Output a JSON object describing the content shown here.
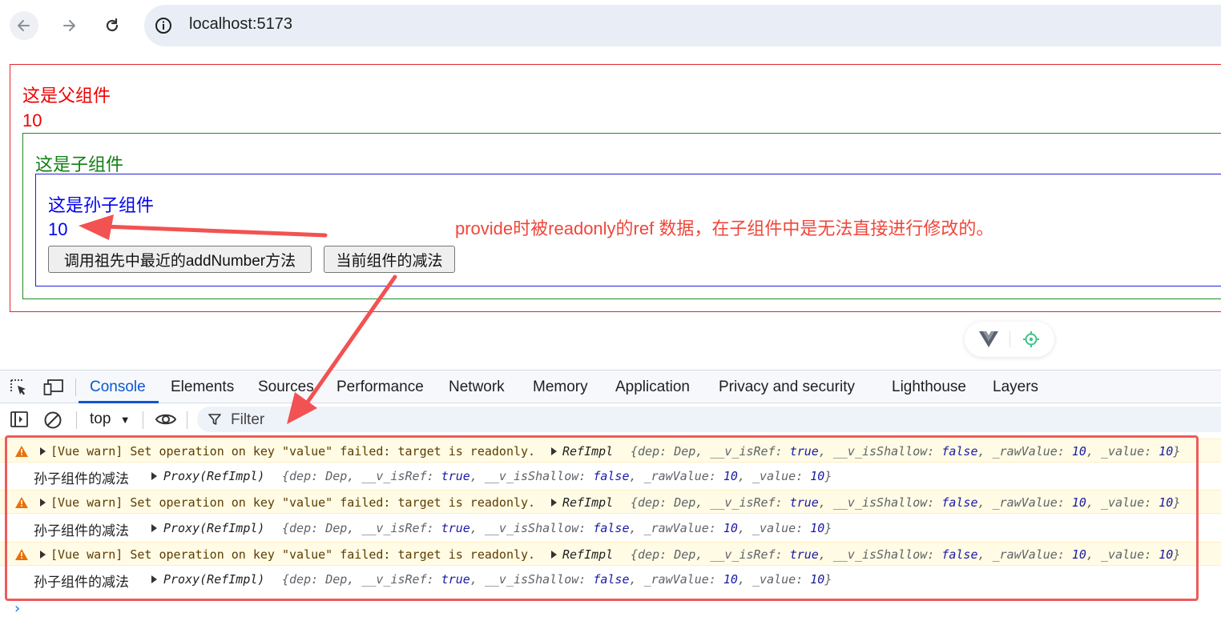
{
  "browser": {
    "url": "localhost:5173",
    "icons": [
      "back-arrow-icon",
      "forward-arrow-icon",
      "reload-icon",
      "site-info-icon"
    ]
  },
  "page": {
    "parent_label": "这是父组件",
    "parent_value": "10",
    "child_label": "这是子组件",
    "grandchild_label": "这是孙子组件",
    "grandchild_value": "10",
    "button_add": "调用祖先中最近的addNumber方法",
    "button_sub": "当前组件的减法",
    "colors": {
      "parent": "#ee0000",
      "child": "#108010",
      "grandchild": "#0000ee"
    }
  },
  "annotation": {
    "text": "provide时被readonly的ref 数据，在子组件中是无法直接进行修改的。",
    "color": "#f0463a"
  },
  "devtools": {
    "tabs": [
      "Console",
      "Elements",
      "Sources",
      "Performance",
      "Network",
      "Memory",
      "Application",
      "Privacy and security",
      "Lighthouse",
      "Layers"
    ],
    "active_tab": "Console",
    "context": "top",
    "filter_placeholder": "Filter",
    "warn_message": "[Vue warn] Set operation on key \"value\" failed: target is readonly.",
    "warn_class": "RefImpl",
    "log_label": "孙子组件的减法",
    "log_class": "Proxy(RefImpl)",
    "object_preview": {
      "open": "{",
      "dep_key": "dep",
      "dep_val": "Dep",
      "isref_key": "__v_isRef",
      "isref_val": "true",
      "shallow_key": "__v_isShallow",
      "shallow_val": "false",
      "raw_key": "_rawValue",
      "raw_val": "10",
      "value_key": "_value",
      "value_val": "10",
      "close": "}"
    },
    "entries": [
      "warn",
      "log",
      "warn",
      "log",
      "warn",
      "log"
    ],
    "prompt": "›"
  }
}
